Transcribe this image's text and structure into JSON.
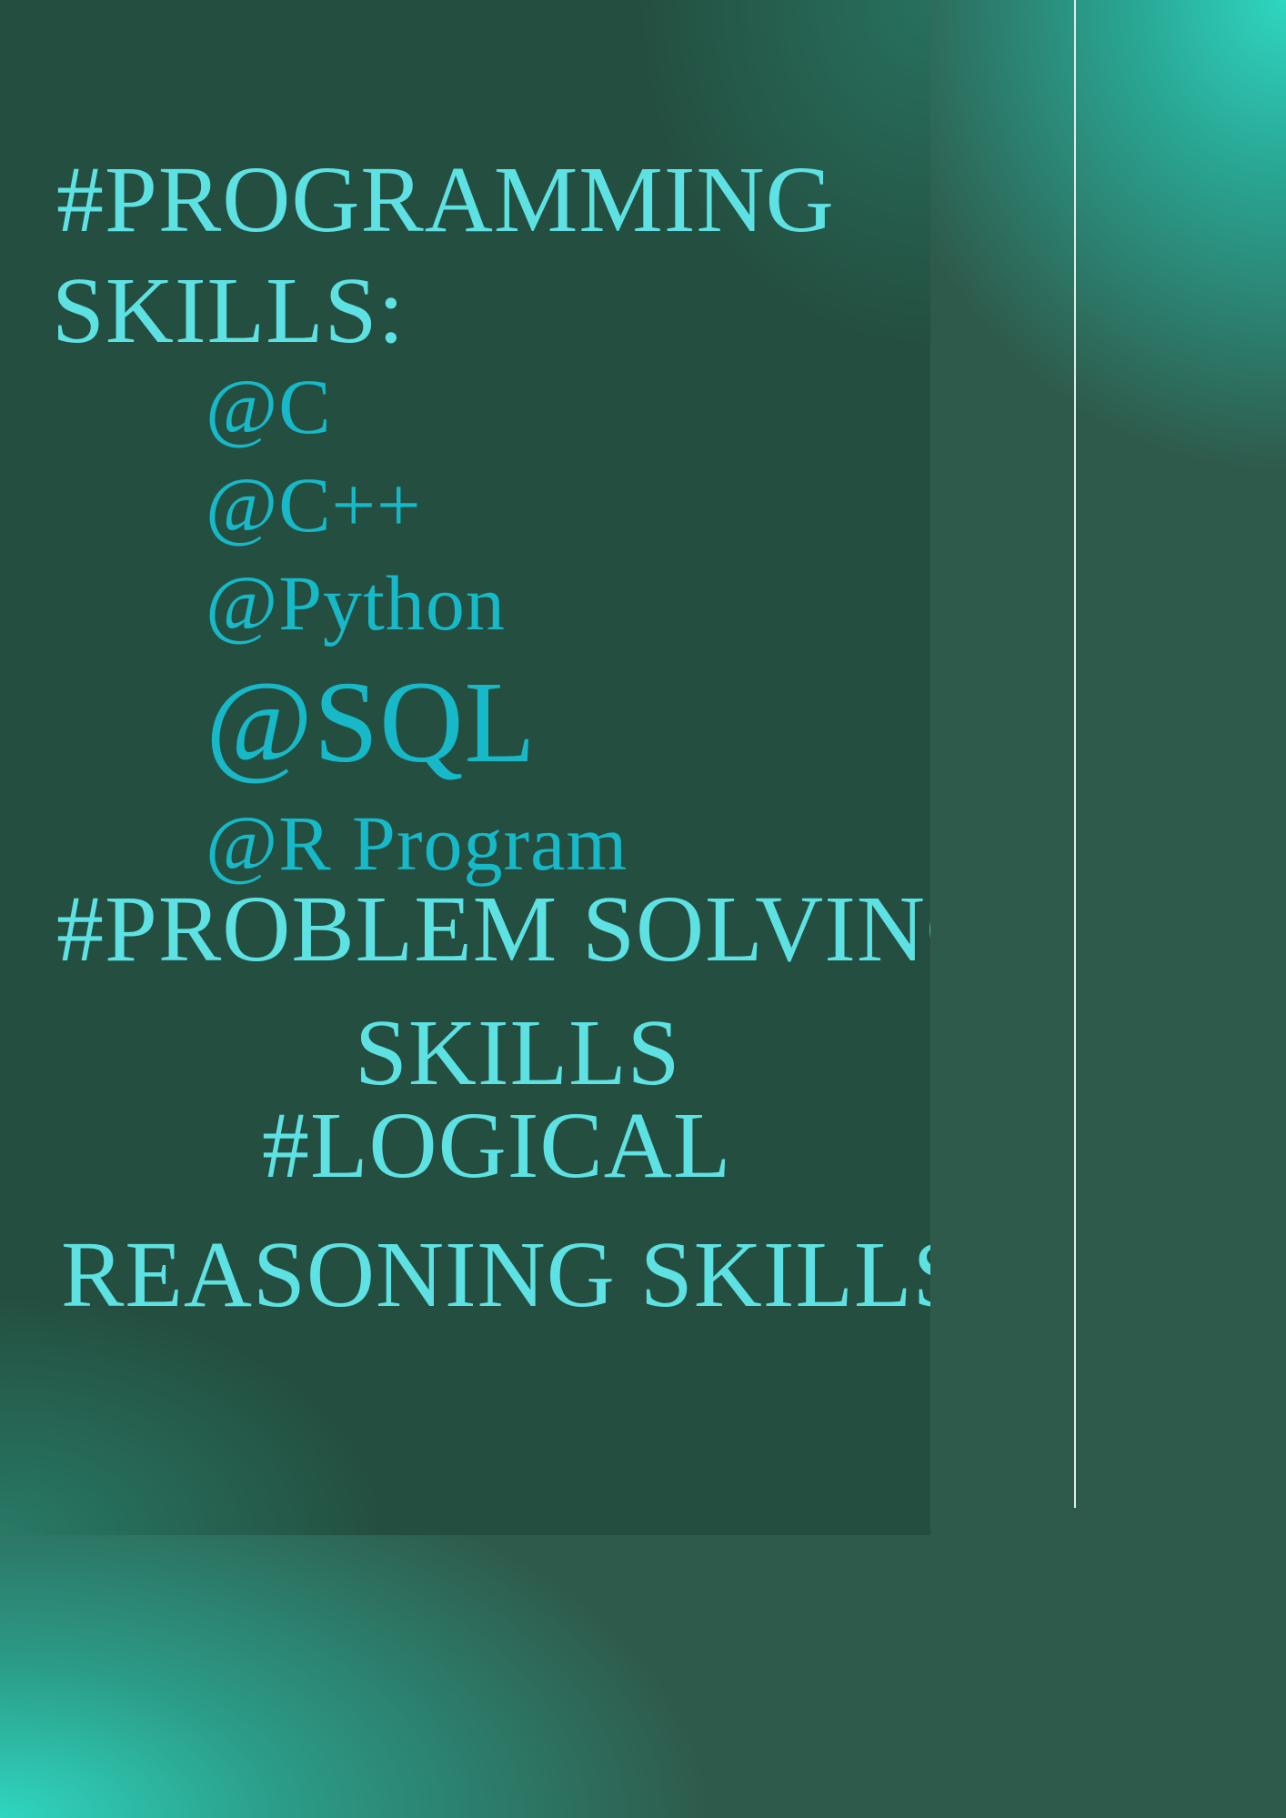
{
  "colors": {
    "background": "#2e5a4b",
    "panel": "#244f40",
    "glow": "#2fd6c0",
    "heading_text": "#5ee1e3",
    "item_text": "#17b8c8",
    "divider": "#dfeee9"
  },
  "programming": {
    "heading_line1": "#PROGRAMMING",
    "heading_line2": "SKILLS:",
    "items": [
      "@C",
      "@C++",
      "@Python",
      "@SQL",
      "@R Program"
    ]
  },
  "problem_solving": {
    "line1": "#PROBLEM SOLVING",
    "line2": "SKILLS"
  },
  "logical_reasoning": {
    "line1": "#LOGICAL",
    "line2": "REASONING SKILLS"
  }
}
